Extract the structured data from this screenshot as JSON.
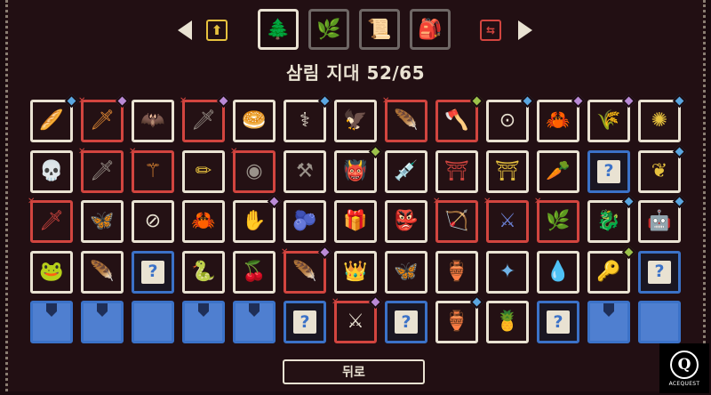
{
  "header": {
    "title": "삼림 지대 52/65"
  },
  "tabs": [
    {
      "icon": "tree-icon",
      "glyph": "🌲",
      "active": true
    },
    {
      "icon": "bush-icon",
      "glyph": "🌿",
      "active": false
    },
    {
      "icon": "scroll-icon",
      "glyph": "📜",
      "active": false
    },
    {
      "icon": "backpack-icon",
      "glyph": "🎒",
      "active": false
    }
  ],
  "nav": {
    "up_glyph": "⬆",
    "sort_glyph": "⇆"
  },
  "grid": [
    {
      "glyph": "🥖",
      "color": "red",
      "border": "cream",
      "badge": "blue"
    },
    {
      "glyph": "🗡",
      "color": "orange",
      "border": "red",
      "badge": "purple",
      "corner": true
    },
    {
      "glyph": "🦇",
      "color": "yellow",
      "border": "cream"
    },
    {
      "glyph": "🗡",
      "color": "gray",
      "border": "red",
      "badge": "purple",
      "corner": true
    },
    {
      "glyph": "🥯",
      "color": "red",
      "border": "cream"
    },
    {
      "glyph": "⚕",
      "color": "cream",
      "border": "cream",
      "badge": "blue"
    },
    {
      "glyph": "🦅",
      "color": "gray",
      "border": "cream"
    },
    {
      "glyph": "🪶",
      "color": "blue",
      "border": "red",
      "corner": true
    },
    {
      "glyph": "🪓",
      "color": "red",
      "border": "red",
      "badge": "green"
    },
    {
      "glyph": "⊙",
      "color": "cream",
      "border": "cream",
      "badge": "blue"
    },
    {
      "glyph": "🦀",
      "color": "red",
      "border": "cream",
      "badge": "purple"
    },
    {
      "glyph": "🌾",
      "color": "green",
      "border": "cream",
      "badge": "purple"
    },
    {
      "glyph": "✺",
      "color": "yellow",
      "border": "cream",
      "badge": "blue"
    },
    {
      "glyph": "💀",
      "color": "cream",
      "border": "cream"
    },
    {
      "glyph": "🗡",
      "color": "gray",
      "border": "red",
      "corner": true
    },
    {
      "glyph": "⚚",
      "color": "orange",
      "border": "red",
      "corner": true
    },
    {
      "glyph": "✏",
      "color": "yellow",
      "border": "cream"
    },
    {
      "glyph": "◉",
      "color": "gray",
      "border": "red",
      "corner": true
    },
    {
      "glyph": "⚒",
      "color": "gray",
      "border": "cream"
    },
    {
      "glyph": "👹",
      "color": "green",
      "border": "cream",
      "badge": "green"
    },
    {
      "glyph": "💉",
      "color": "blue",
      "border": "cream"
    },
    {
      "glyph": "⛩",
      "color": "red",
      "border": "cream"
    },
    {
      "glyph": "⛩",
      "color": "yellow",
      "border": "cream"
    },
    {
      "glyph": "🥕",
      "color": "orange",
      "border": "cream"
    },
    {
      "unknown": true,
      "q": "?"
    },
    {
      "glyph": "❦",
      "color": "yellow",
      "border": "cream",
      "badge": "blue"
    },
    {
      "glyph": "🗡",
      "color": "red",
      "border": "red",
      "corner": true
    },
    {
      "glyph": "🦋",
      "color": "green",
      "border": "cream"
    },
    {
      "glyph": "⊘",
      "color": "cream",
      "border": "cream"
    },
    {
      "glyph": "🦀",
      "color": "red",
      "border": "cream"
    },
    {
      "glyph": "✋",
      "color": "red",
      "border": "cream",
      "badge": "purple"
    },
    {
      "glyph": "🫐",
      "color": "navy",
      "border": "cream"
    },
    {
      "glyph": "🎁",
      "color": "red",
      "border": "cream"
    },
    {
      "glyph": "👺",
      "color": "red",
      "border": "cream"
    },
    {
      "glyph": "🏹",
      "color": "red",
      "border": "red",
      "corner": true
    },
    {
      "glyph": "⚔",
      "color": "navy",
      "border": "red",
      "corner": true
    },
    {
      "glyph": "🌿",
      "color": "green",
      "border": "red",
      "corner": true
    },
    {
      "glyph": "🐉",
      "color": "red",
      "border": "cream",
      "badge": "blue"
    },
    {
      "glyph": "🤖",
      "color": "blue",
      "border": "cream",
      "badge": "blue"
    },
    {
      "glyph": "🐸",
      "color": "green",
      "border": "cream"
    },
    {
      "glyph": "🪶",
      "color": "yellow",
      "border": "cream"
    },
    {
      "unknown": true,
      "q": "?"
    },
    {
      "glyph": "🐍",
      "color": "green",
      "border": "cream"
    },
    {
      "glyph": "🍒",
      "color": "red",
      "border": "cream"
    },
    {
      "glyph": "🪶",
      "color": "gray",
      "border": "red",
      "badge": "purple",
      "corner": true
    },
    {
      "glyph": "👑",
      "color": "gray",
      "border": "cream"
    },
    {
      "glyph": "🦋",
      "color": "yellow",
      "border": "cream"
    },
    {
      "glyph": "🏺",
      "color": "gray",
      "border": "cream"
    },
    {
      "glyph": "✦",
      "color": "blue",
      "border": "cream"
    },
    {
      "glyph": "💧",
      "color": "gray",
      "border": "cream"
    },
    {
      "glyph": "🔑",
      "color": "yellow",
      "border": "cream",
      "badge": "green"
    },
    {
      "unknown": true,
      "q": "?"
    },
    {
      "locked": true,
      "marked": true
    },
    {
      "locked": true,
      "marked": true
    },
    {
      "locked": true,
      "marked": false
    },
    {
      "locked": true,
      "marked": true
    },
    {
      "locked": true,
      "marked": true
    },
    {
      "unknown": true,
      "q": "?"
    },
    {
      "glyph": "⚔",
      "color": "cream",
      "border": "red",
      "badge": "purple",
      "corner": true
    },
    {
      "unknown": true,
      "q": "?"
    },
    {
      "glyph": "🏺",
      "color": "gray",
      "border": "cream",
      "badge": "blue"
    },
    {
      "glyph": "🍍",
      "color": "green",
      "border": "cream"
    },
    {
      "unknown": true,
      "q": "?"
    },
    {
      "locked": true,
      "marked": true
    },
    {
      "locked": true,
      "marked": false
    }
  ],
  "footer": {
    "back_label": "뒤로"
  },
  "logo": {
    "mark": "Q",
    "text": "ACEQUEST"
  },
  "colors": {
    "background": "#220f13",
    "cream": "#e9e2d2",
    "red": "#d2453f",
    "blue_frame": "#3b72c8",
    "yellow": "#e6c13e"
  }
}
